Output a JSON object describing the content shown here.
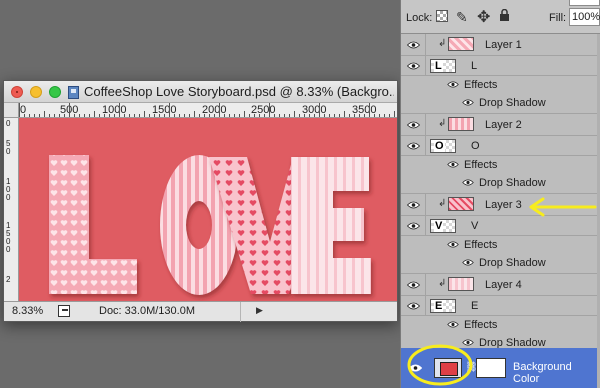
{
  "window": {
    "title": "CoffeeShop Love Storyboard.psd @ 8.33% (Backgro..."
  },
  "rulers": {
    "horizontal_labels": [
      "0",
      "500",
      "1000",
      "1500",
      "2000",
      "2500",
      "3000",
      "3500"
    ],
    "vertical_labels": [
      "0",
      "5",
      "0",
      "1",
      "0",
      "0",
      "1",
      "5",
      "0",
      "0",
      "2"
    ]
  },
  "canvas": {
    "text": "LOVE",
    "background_color": "#df5c62",
    "pattern_color": "#f6c7cf"
  },
  "status": {
    "zoom": "8.33%",
    "doc": "Doc: 33.0M/130.0M"
  },
  "layers_panel": {
    "lock_label": "Lock:",
    "fill_label": "Fill:",
    "fill_value": "100%",
    "layers": [
      {
        "name": "Layer 1",
        "type": "pattern",
        "clipped": true
      },
      {
        "name": "L",
        "type": "text",
        "effects_label": "Effects",
        "effect": "Drop Shadow"
      },
      {
        "name": "Layer 2",
        "type": "pattern",
        "clipped": true
      },
      {
        "name": "O",
        "type": "text",
        "effects_label": "Effects",
        "effect": "Drop Shadow"
      },
      {
        "name": "Layer 3",
        "type": "pattern",
        "clipped": true
      },
      {
        "name": "V",
        "type": "text",
        "effects_label": "Effects",
        "effect": "Drop Shadow"
      },
      {
        "name": "Layer 4",
        "type": "pattern",
        "clipped": true
      },
      {
        "name": "E",
        "type": "text",
        "effects_label": "Effects",
        "effect": "Drop Shadow"
      }
    ],
    "background_layer": {
      "name": "Background Color",
      "swatch_color": "#df3f46"
    }
  },
  "annotations": {
    "highlight_color": "#f7ec1e"
  },
  "icons": [
    "eye-icon",
    "brush-icon",
    "move-icon",
    "lock-icon",
    "clip-arrow-icon",
    "export-icon",
    "document-icon"
  ]
}
